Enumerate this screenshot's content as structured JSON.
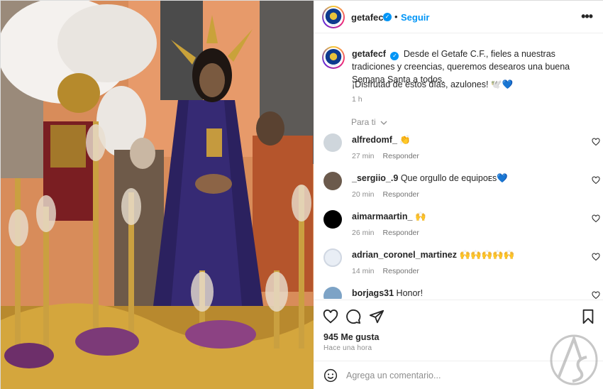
{
  "post": {
    "username": "getafecf",
    "follow_label": "Seguir",
    "separator": "•",
    "more_label": "•••",
    "caption_user": "getafecf",
    "caption_text": "Desde el Getafe C.F., fieles a nuestras tradiciones y creencias, queremos desearos una buena Semana Santa a todos.",
    "caption_line2": "¡Disfrutad de estos días, azulones! 🕊️",
    "caption_heart": "💙",
    "caption_time": "1 h",
    "filter_label": "Para ti",
    "likes": "945 Me gusta",
    "posted_ago": "Hace una hora",
    "add_comment_placeholder": "Agrega un comentario..."
  },
  "comments": [
    {
      "user": "alfredomf_",
      "text": "👏",
      "time": "27 min",
      "reply": "Responder",
      "avatar_color": "#cfd6dc"
    },
    {
      "user": "_sergiio_.9",
      "text": "Que orgullo de equipoᴇs💙",
      "time": "20 min",
      "reply": "Responder",
      "avatar_color": "#6b5a4c"
    },
    {
      "user": "aimarmaartin_",
      "text": "🙌",
      "time": "26 min",
      "reply": "Responder",
      "avatar_color": "#000000"
    },
    {
      "user": "adrian_coronel_martinez",
      "text": "🙌🙌🙌🙌🙌",
      "time": "14 min",
      "reply": "Responder",
      "avatar_color": "#e9eef5"
    },
    {
      "user": "borjags31",
      "text": "Honor!",
      "time": "",
      "reply": "",
      "avatar_color": "#7da3c6"
    }
  ],
  "colors": {
    "accent": "#0095f6",
    "text": "#262626",
    "muted": "#8e8e8e"
  }
}
